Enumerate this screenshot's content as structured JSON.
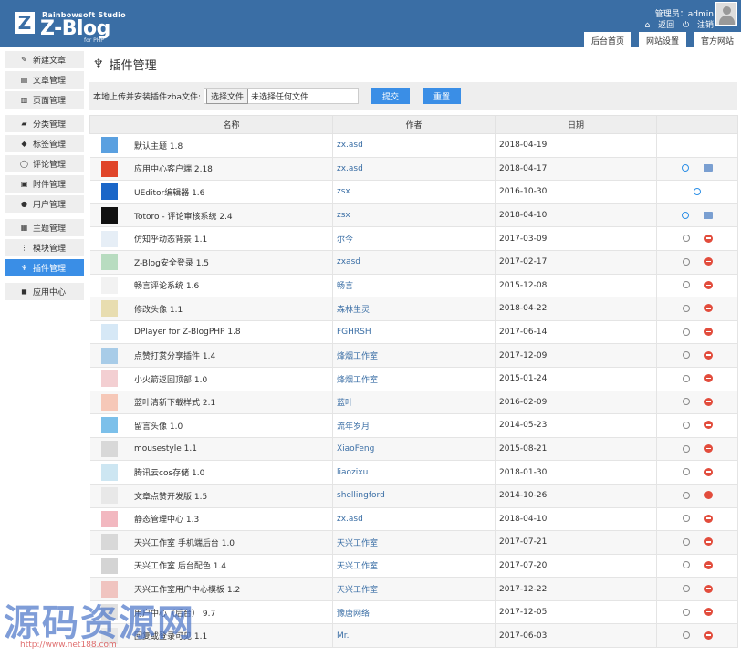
{
  "header": {
    "logo_letter": "Z",
    "studio": "Rainbowsoft Studio",
    "name": "Z-Blog",
    "php": "for PHP",
    "user": "管理员：admin",
    "back": "返回",
    "logout": "注销",
    "tabs": [
      "后台首页",
      "网站设置",
      "官方网站"
    ]
  },
  "sidebar": {
    "items": [
      {
        "label": "新建文章",
        "icon": "edit-icon"
      },
      {
        "label": "文章管理",
        "icon": "document-icon"
      },
      {
        "label": "页面管理",
        "icon": "page-icon"
      },
      {
        "label": "分类管理",
        "icon": "folder-icon"
      },
      {
        "label": "标签管理",
        "icon": "tag-icon"
      },
      {
        "label": "评论管理",
        "icon": "comment-icon"
      },
      {
        "label": "附件管理",
        "icon": "attachment-icon"
      },
      {
        "label": "用户管理",
        "icon": "user-icon"
      },
      {
        "label": "主题管理",
        "icon": "theme-icon"
      },
      {
        "label": "模块管理",
        "icon": "module-icon"
      },
      {
        "label": "插件管理",
        "icon": "plugin-icon"
      },
      {
        "label": "应用中心",
        "icon": "box-icon"
      }
    ]
  },
  "main": {
    "title": "插件管理",
    "upload_label": "本地上传并安装插件zba文件:",
    "file_button": "选择文件",
    "file_status": "未选择任何文件",
    "submit": "提交",
    "reset": "重置",
    "columns": [
      "名称",
      "作者",
      "日期"
    ],
    "rows": [
      {
        "name": "默认主题 1.8",
        "author": "zx.asd",
        "date": "2018-04-19",
        "color": "#5aa0e0",
        "actions": []
      },
      {
        "name": "应用中心客户端 2.18",
        "author": "zx.asd",
        "date": "2018-04-17",
        "color": "#e0452a",
        "actions": [
          "power-on",
          "tool"
        ]
      },
      {
        "name": "UEditor编辑器 1.6",
        "author": "zsx",
        "date": "2016-10-30",
        "color": "#1a66c8",
        "actions": [
          "power-on-center"
        ]
      },
      {
        "name": "Totoro - 评论审核系统 2.4",
        "author": "zsx",
        "date": "2018-04-10",
        "color": "#111111",
        "actions": [
          "power-on",
          "tool"
        ]
      },
      {
        "name": "仿知乎动态背景 1.1",
        "author": "尔今",
        "date": "2017-03-09",
        "color": "#e6eef6",
        "actions": [
          "power",
          "remove"
        ]
      },
      {
        "name": "Z-Blog安全登录 1.5",
        "author": "zxasd",
        "date": "2017-02-17",
        "color": "#b8dcc0",
        "actions": [
          "power",
          "remove"
        ]
      },
      {
        "name": "畅言评论系统 1.6",
        "author": "畅言",
        "date": "2015-12-08",
        "color": "#f2f2f2",
        "actions": [
          "power",
          "remove"
        ]
      },
      {
        "name": "修改头像 1.1",
        "author": "森林生灵",
        "date": "2018-04-22",
        "color": "#e8ddb0",
        "actions": [
          "power",
          "remove"
        ]
      },
      {
        "name": "DPlayer for Z-BlogPHP 1.8",
        "author": "FGHRSH",
        "date": "2017-06-14",
        "color": "#d6e8f6",
        "actions": [
          "power",
          "remove"
        ]
      },
      {
        "name": "点赞打赏分享插件 1.4",
        "author": "烽烟工作室",
        "date": "2017-12-09",
        "color": "#a8cce8",
        "actions": [
          "power",
          "remove"
        ]
      },
      {
        "name": "小火箭返回顶部 1.0",
        "author": "烽烟工作室",
        "date": "2015-01-24",
        "color": "#f3cfd2",
        "actions": [
          "power",
          "remove"
        ]
      },
      {
        "name": "蓝叶清新下载样式 2.1",
        "author": "蓝叶",
        "date": "2016-02-09",
        "color": "#f6c8b8",
        "actions": [
          "power",
          "remove"
        ]
      },
      {
        "name": "留言头像 1.0",
        "author": "流年岁月",
        "date": "2014-05-23",
        "color": "#7cc0ea",
        "actions": [
          "power",
          "remove"
        ]
      },
      {
        "name": "mousestyle 1.1",
        "author": "XiaoFeng",
        "date": "2015-08-21",
        "color": "#d8d8d8",
        "actions": [
          "power",
          "remove"
        ]
      },
      {
        "name": "腾讯云cos存储 1.0",
        "author": "liaozixu",
        "date": "2018-01-30",
        "color": "#cde6f2",
        "actions": [
          "power",
          "remove"
        ]
      },
      {
        "name": "文章点赞开发版 1.5",
        "author": "shellingford",
        "date": "2014-10-26",
        "color": "#e8e8e8",
        "actions": [
          "power",
          "remove"
        ]
      },
      {
        "name": "静态管理中心 1.3",
        "author": "zx.asd",
        "date": "2018-04-10",
        "color": "#f2b8c0",
        "actions": [
          "power",
          "remove"
        ]
      },
      {
        "name": "天兴工作室 手机端后台 1.0",
        "author": "天兴工作室",
        "date": "2017-07-21",
        "color": "#d8d8d8",
        "actions": [
          "power",
          "remove"
        ]
      },
      {
        "name": "天兴工作室 后台配色 1.4",
        "author": "天兴工作室",
        "date": "2017-07-20",
        "color": "#d4d4d4",
        "actions": [
          "power",
          "remove"
        ]
      },
      {
        "name": "天兴工作室用户中心模板 1.2",
        "author": "天兴工作室",
        "date": "2017-12-22",
        "color": "#f0c4c0",
        "actions": [
          "power",
          "remove"
        ]
      },
      {
        "name": "用户中心（后台） 9.7",
        "author": "豫唐网络",
        "date": "2017-12-05",
        "color": "#e0e0e0",
        "actions": [
          "power",
          "remove"
        ]
      },
      {
        "name": "回复或登录可见 1.1",
        "author": "Mr.",
        "date": "2017-06-03",
        "color": "#e8e8e8",
        "actions": [
          "power",
          "remove"
        ]
      }
    ]
  },
  "watermark": {
    "text": "源码资源网",
    "url": "http://www.net188.com"
  }
}
